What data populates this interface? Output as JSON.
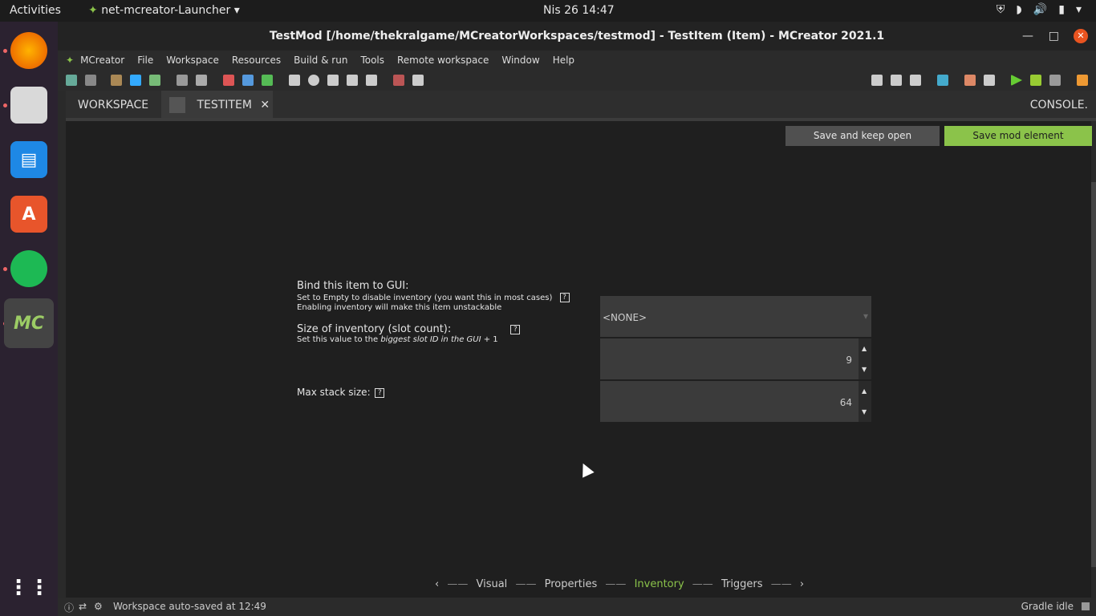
{
  "system": {
    "activities": "Activities",
    "app_name": "net-mcreator-Launcher",
    "clock": "Nis 26  14:47"
  },
  "window": {
    "title": "TestMod [/home/thekralgame/MCreatorWorkspaces/testmod] - TestItem (Item) - MCreator 2021.1",
    "minimize": "—",
    "maximize": "□",
    "close": "✕"
  },
  "menu": [
    "MCreator",
    "File",
    "Workspace",
    "Resources",
    "Build & run",
    "Tools",
    "Remote workspace",
    "Window",
    "Help"
  ],
  "tabs": {
    "workspace": "WORKSPACE",
    "testitem": "TESTITEM",
    "console": "CONSOLE."
  },
  "actions": {
    "save_keep_open": "Save and keep open",
    "save_element": "Save mod element"
  },
  "form": {
    "bind_label": "Bind this item to GUI:",
    "bind_desc1": "Set to Empty to disable inventory (you want this in most cases)",
    "bind_desc2": "Enabling inventory will make this item unstackable",
    "bind_value": "<NONE>",
    "size_label": "Size of inventory (slot count):",
    "size_desc_prefix": "Set this value to the ",
    "size_desc_italic": "biggest slot ID in the GUI",
    "size_desc_suffix": " + 1",
    "size_value": "9",
    "stack_label": "Max stack size:",
    "stack_value": "64",
    "help_glyph": "?"
  },
  "pager": {
    "visual": "Visual",
    "properties": "Properties",
    "inventory": "Inventory",
    "triggers": "Triggers"
  },
  "status": {
    "autosave": "Workspace auto-saved at 12:49",
    "gradle": "Gradle idle"
  },
  "colors": {
    "accent_green": "#8bc34a",
    "active_text": "#8bc34a"
  }
}
